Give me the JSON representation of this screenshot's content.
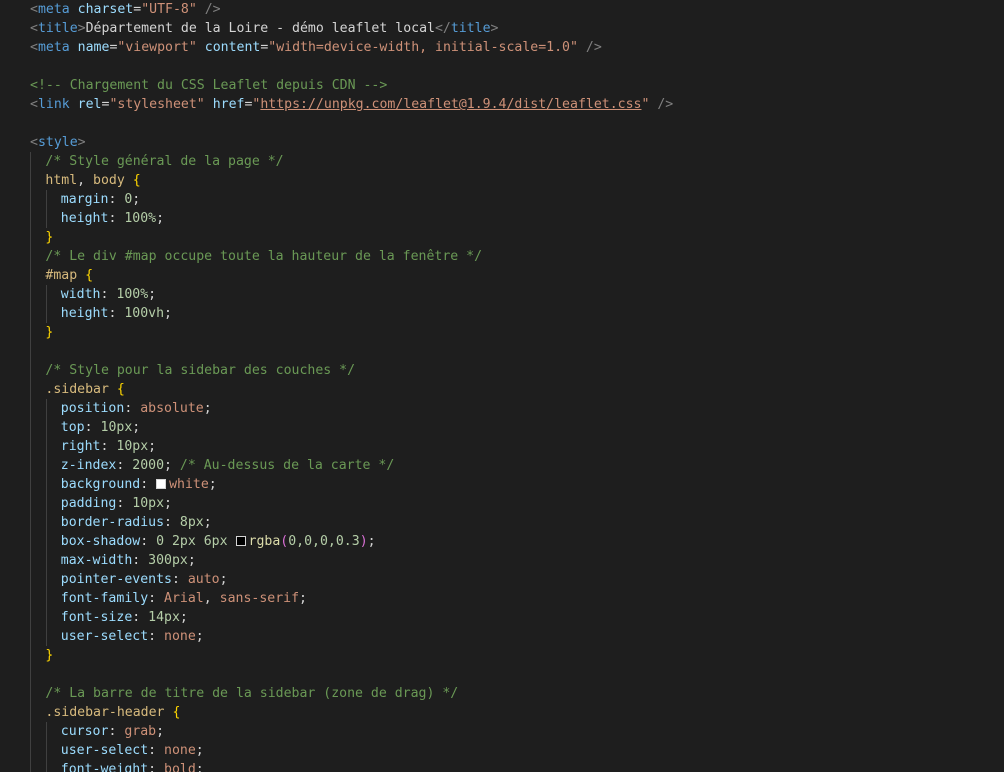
{
  "theme": {
    "background": "#1e1e1e",
    "tag": "#569cd6",
    "attr": "#9cdcfe",
    "string": "#ce9178",
    "comment": "#6a9955",
    "selector_tag": "#d7ba7d",
    "number": "#b5cea8",
    "brace": "#ffd700",
    "paren": "#da70d6",
    "func": "#dcdcaa",
    "text": "#d4d4d4",
    "punct": "#808080"
  },
  "editor": {
    "lines": [
      {
        "indent": 1,
        "guides": [],
        "tokens": [
          [
            "<",
            "punct"
          ],
          [
            "meta",
            "tag"
          ],
          [
            " ",
            "text"
          ],
          [
            "charset",
            "attr"
          ],
          [
            "=",
            "text"
          ],
          [
            "\"UTF-8\"",
            "string"
          ],
          [
            " />",
            "punct"
          ]
        ]
      },
      {
        "indent": 1,
        "guides": [],
        "tokens": [
          [
            "<",
            "punct"
          ],
          [
            "title",
            "tag"
          ],
          [
            ">",
            "punct"
          ],
          [
            "Département de la Loire - démo leaflet local",
            "text"
          ],
          [
            "</",
            "punct"
          ],
          [
            "title",
            "tag"
          ],
          [
            ">",
            "punct"
          ]
        ]
      },
      {
        "indent": 1,
        "guides": [],
        "tokens": [
          [
            "<",
            "punct"
          ],
          [
            "meta",
            "tag"
          ],
          [
            " ",
            "text"
          ],
          [
            "name",
            "attr"
          ],
          [
            "=",
            "text"
          ],
          [
            "\"viewport\"",
            "string"
          ],
          [
            " ",
            "text"
          ],
          [
            "content",
            "attr"
          ],
          [
            "=",
            "text"
          ],
          [
            "\"width=device-width, initial-scale=1.0\"",
            "string"
          ],
          [
            " />",
            "punct"
          ]
        ]
      },
      {
        "indent": 0,
        "guides": [],
        "tokens": []
      },
      {
        "indent": 1,
        "guides": [],
        "tokens": [
          [
            "<!-- Chargement du CSS Leaflet depuis CDN -->",
            "comment"
          ]
        ]
      },
      {
        "indent": 1,
        "guides": [],
        "tokens": [
          [
            "<",
            "punct"
          ],
          [
            "link",
            "tag"
          ],
          [
            " ",
            "text"
          ],
          [
            "rel",
            "attr"
          ],
          [
            "=",
            "text"
          ],
          [
            "\"stylesheet\"",
            "string"
          ],
          [
            " ",
            "text"
          ],
          [
            "href",
            "attr"
          ],
          [
            "=",
            "text"
          ],
          [
            "\"",
            "string"
          ],
          [
            "https://unpkg.com/leaflet@1.9.4/dist/leaflet.css",
            "string",
            "link"
          ],
          [
            "\"",
            "string"
          ],
          [
            " />",
            "punct"
          ]
        ]
      },
      {
        "indent": 0,
        "guides": [],
        "tokens": []
      },
      {
        "indent": 1,
        "guides": [],
        "tokens": [
          [
            "<",
            "punct"
          ],
          [
            "style",
            "tag"
          ],
          [
            ">",
            "punct"
          ]
        ]
      },
      {
        "indent": 2,
        "guides": [
          1
        ],
        "tokens": [
          [
            "/* Style général de la page */",
            "comment"
          ]
        ]
      },
      {
        "indent": 2,
        "guides": [
          1
        ],
        "tokens": [
          [
            "html",
            "selector_tag"
          ],
          [
            ", ",
            "text"
          ],
          [
            "body",
            "selector_tag"
          ],
          [
            " ",
            "text"
          ],
          [
            "{",
            "brace"
          ]
        ]
      },
      {
        "indent": 3,
        "guides": [
          1,
          2
        ],
        "tokens": [
          [
            "margin",
            "attr"
          ],
          [
            ": ",
            "text"
          ],
          [
            "0",
            "number"
          ],
          [
            ";",
            "text"
          ]
        ]
      },
      {
        "indent": 3,
        "guides": [
          1,
          2
        ],
        "tokens": [
          [
            "height",
            "attr"
          ],
          [
            ": ",
            "text"
          ],
          [
            "100%",
            "number"
          ],
          [
            ";",
            "text"
          ]
        ]
      },
      {
        "indent": 2,
        "guides": [
          1
        ],
        "tokens": [
          [
            "}",
            "brace"
          ]
        ]
      },
      {
        "indent": 2,
        "guides": [
          1
        ],
        "tokens": [
          [
            "/* Le div #map occupe toute la hauteur de la fenêtre */",
            "comment"
          ]
        ]
      },
      {
        "indent": 2,
        "guides": [
          1
        ],
        "tokens": [
          [
            "#map",
            "selector_tag"
          ],
          [
            " ",
            "text"
          ],
          [
            "{",
            "brace"
          ]
        ]
      },
      {
        "indent": 3,
        "guides": [
          1,
          2
        ],
        "tokens": [
          [
            "width",
            "attr"
          ],
          [
            ": ",
            "text"
          ],
          [
            "100%",
            "number"
          ],
          [
            ";",
            "text"
          ]
        ]
      },
      {
        "indent": 3,
        "guides": [
          1,
          2
        ],
        "tokens": [
          [
            "height",
            "attr"
          ],
          [
            ": ",
            "text"
          ],
          [
            "100vh",
            "number"
          ],
          [
            ";",
            "text"
          ]
        ]
      },
      {
        "indent": 2,
        "guides": [
          1
        ],
        "tokens": [
          [
            "}",
            "brace"
          ]
        ]
      },
      {
        "indent": 0,
        "guides": [
          1
        ],
        "tokens": []
      },
      {
        "indent": 2,
        "guides": [
          1
        ],
        "tokens": [
          [
            "/* Style pour la sidebar des couches */",
            "comment"
          ]
        ]
      },
      {
        "indent": 2,
        "guides": [
          1
        ],
        "tokens": [
          [
            ".sidebar",
            "selector_tag"
          ],
          [
            " ",
            "text"
          ],
          [
            "{",
            "brace"
          ]
        ]
      },
      {
        "indent": 3,
        "guides": [
          1,
          2
        ],
        "tokens": [
          [
            "position",
            "attr"
          ],
          [
            ": ",
            "text"
          ],
          [
            "absolute",
            "string"
          ],
          [
            ";",
            "text"
          ]
        ]
      },
      {
        "indent": 3,
        "guides": [
          1,
          2
        ],
        "tokens": [
          [
            "top",
            "attr"
          ],
          [
            ": ",
            "text"
          ],
          [
            "10px",
            "number"
          ],
          [
            ";",
            "text"
          ]
        ]
      },
      {
        "indent": 3,
        "guides": [
          1,
          2
        ],
        "tokens": [
          [
            "right",
            "attr"
          ],
          [
            ": ",
            "text"
          ],
          [
            "10px",
            "number"
          ],
          [
            ";",
            "text"
          ]
        ]
      },
      {
        "indent": 3,
        "guides": [
          1,
          2
        ],
        "tokens": [
          [
            "z-index",
            "attr"
          ],
          [
            ": ",
            "text"
          ],
          [
            "2000",
            "number"
          ],
          [
            "; ",
            "text"
          ],
          [
            "/* Au-dessus de la carte */",
            "comment"
          ]
        ]
      },
      {
        "indent": 3,
        "guides": [
          1,
          2
        ],
        "tokens": [
          [
            "background",
            "attr"
          ],
          [
            ": ",
            "text"
          ],
          [
            "",
            "swatch_white"
          ],
          [
            "white",
            "string"
          ],
          [
            ";",
            "text"
          ]
        ]
      },
      {
        "indent": 3,
        "guides": [
          1,
          2
        ],
        "tokens": [
          [
            "padding",
            "attr"
          ],
          [
            ": ",
            "text"
          ],
          [
            "10px",
            "number"
          ],
          [
            ";",
            "text"
          ]
        ]
      },
      {
        "indent": 3,
        "guides": [
          1,
          2
        ],
        "tokens": [
          [
            "border-radius",
            "attr"
          ],
          [
            ": ",
            "text"
          ],
          [
            "8px",
            "number"
          ],
          [
            ";",
            "text"
          ]
        ]
      },
      {
        "indent": 3,
        "guides": [
          1,
          2
        ],
        "tokens": [
          [
            "box-shadow",
            "attr"
          ],
          [
            ": ",
            "text"
          ],
          [
            "0 2px 6px ",
            "number"
          ],
          [
            "",
            "swatch_dark"
          ],
          [
            "rgba",
            "func"
          ],
          [
            "(",
            "paren"
          ],
          [
            "0,0,0,0.3",
            "number"
          ],
          [
            ")",
            "paren"
          ],
          [
            ";",
            "text"
          ]
        ]
      },
      {
        "indent": 3,
        "guides": [
          1,
          2
        ],
        "tokens": [
          [
            "max-width",
            "attr"
          ],
          [
            ": ",
            "text"
          ],
          [
            "300px",
            "number"
          ],
          [
            ";",
            "text"
          ]
        ]
      },
      {
        "indent": 3,
        "guides": [
          1,
          2
        ],
        "tokens": [
          [
            "pointer-events",
            "attr"
          ],
          [
            ": ",
            "text"
          ],
          [
            "auto",
            "string"
          ],
          [
            ";",
            "text"
          ]
        ]
      },
      {
        "indent": 3,
        "guides": [
          1,
          2
        ],
        "tokens": [
          [
            "font-family",
            "attr"
          ],
          [
            ": ",
            "text"
          ],
          [
            "Arial",
            "string"
          ],
          [
            ", ",
            "text"
          ],
          [
            "sans-serif",
            "string"
          ],
          [
            ";",
            "text"
          ]
        ]
      },
      {
        "indent": 3,
        "guides": [
          1,
          2
        ],
        "tokens": [
          [
            "font-size",
            "attr"
          ],
          [
            ": ",
            "text"
          ],
          [
            "14px",
            "number"
          ],
          [
            ";",
            "text"
          ]
        ]
      },
      {
        "indent": 3,
        "guides": [
          1,
          2
        ],
        "tokens": [
          [
            "user-select",
            "attr"
          ],
          [
            ": ",
            "text"
          ],
          [
            "none",
            "string"
          ],
          [
            ";",
            "text"
          ]
        ]
      },
      {
        "indent": 2,
        "guides": [
          1
        ],
        "tokens": [
          [
            "}",
            "brace"
          ]
        ]
      },
      {
        "indent": 0,
        "guides": [
          1
        ],
        "tokens": []
      },
      {
        "indent": 2,
        "guides": [
          1
        ],
        "tokens": [
          [
            "/* La barre de titre de la sidebar (zone de drag) */",
            "comment"
          ]
        ]
      },
      {
        "indent": 2,
        "guides": [
          1
        ],
        "tokens": [
          [
            ".sidebar-header",
            "selector_tag"
          ],
          [
            " ",
            "text"
          ],
          [
            "{",
            "brace"
          ]
        ]
      },
      {
        "indent": 3,
        "guides": [
          1,
          2
        ],
        "tokens": [
          [
            "cursor",
            "attr"
          ],
          [
            ": ",
            "text"
          ],
          [
            "grab",
            "string"
          ],
          [
            ";",
            "text"
          ]
        ]
      },
      {
        "indent": 3,
        "guides": [
          1,
          2
        ],
        "tokens": [
          [
            "user-select",
            "attr"
          ],
          [
            ": ",
            "text"
          ],
          [
            "none",
            "string"
          ],
          [
            ";",
            "text"
          ]
        ]
      },
      {
        "indent": 3,
        "guides": [
          1,
          2
        ],
        "tokens": [
          [
            "font-weight",
            "attr"
          ],
          [
            ": ",
            "text"
          ],
          [
            "bold",
            "string"
          ],
          [
            ";",
            "text"
          ]
        ]
      }
    ]
  }
}
